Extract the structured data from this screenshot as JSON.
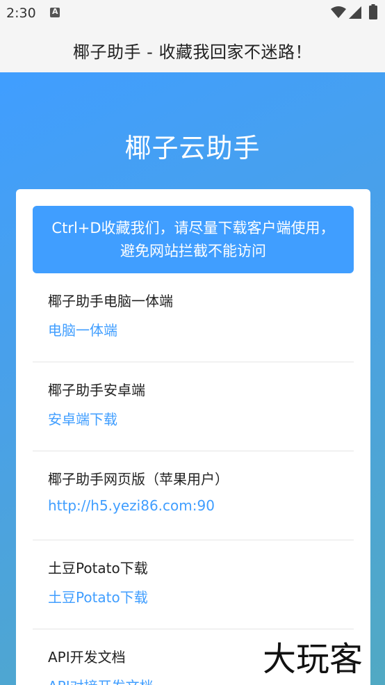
{
  "status_bar": {
    "time": "2:30",
    "icons": [
      "app-notification-icon",
      "wifi-icon",
      "signal-icon",
      "battery-icon"
    ]
  },
  "title_bar": {
    "title": "椰子助手 - 收藏我回家不迷路！"
  },
  "hero": {
    "title": "椰子云助手"
  },
  "notice": {
    "line1": "Ctrl+D收藏我们，请尽量下载客户端使用，",
    "line2": "避免网站拦截不能访问"
  },
  "items": [
    {
      "title": "椰子助手电脑一体端",
      "link": "电脑一体端"
    },
    {
      "title": "椰子助手安卓端",
      "link": "安卓端下载"
    },
    {
      "title": "椰子助手网页版（苹果用户）",
      "link": "http://h5.yezi86.com:90"
    },
    {
      "title": "土豆Potato下载",
      "link": "土豆Potato下载"
    },
    {
      "title": "API开发文档",
      "link": "API对接开发文档"
    }
  ],
  "watermark": {
    "text": "大玩客"
  },
  "colors": {
    "accent": "#409eff",
    "gradient_start": "#409eff",
    "gradient_end": "#51a9c3",
    "status_bar_bg": "#f5f5f5"
  }
}
